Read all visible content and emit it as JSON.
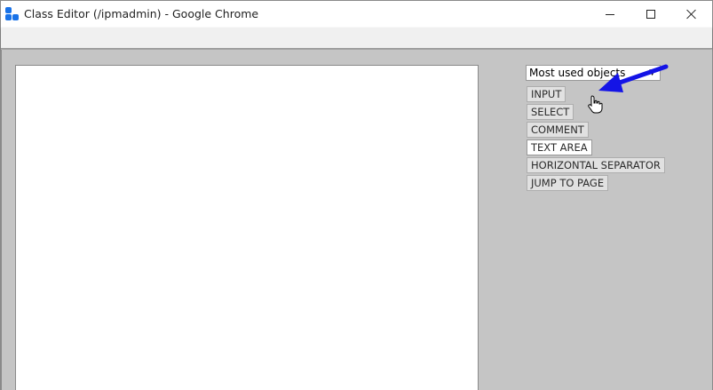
{
  "window": {
    "title": "Class Editor (/ipmadmin) - Google Chrome",
    "controls": {
      "minimize": "minimize-icon",
      "maximize": "maximize-icon",
      "close": "close-icon"
    }
  },
  "panel": {
    "object_select": {
      "selected": "Most used objects"
    },
    "buttons": [
      {
        "label": "INPUT"
      },
      {
        "label": "SELECT"
      },
      {
        "label": "COMMENT"
      },
      {
        "label": "TEXT AREA"
      },
      {
        "label": "HORIZONTAL SEPARATOR"
      },
      {
        "label": "JUMP TO PAGE"
      }
    ]
  },
  "colors": {
    "accent_arrow": "#1414e6",
    "background": "#c5c5c5",
    "app_icon": "#1a73e8"
  }
}
